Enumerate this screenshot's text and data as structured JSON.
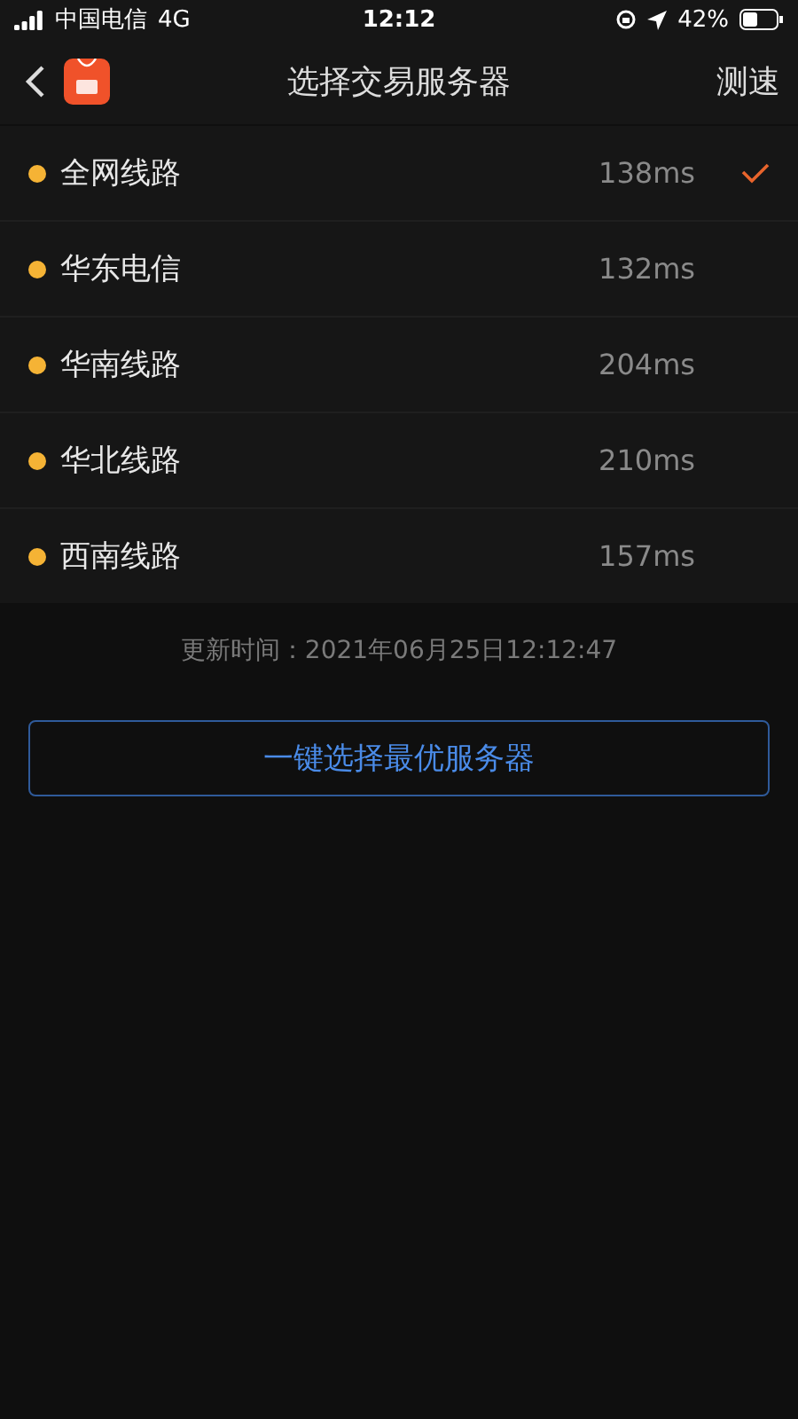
{
  "status_bar": {
    "carrier": "中国电信",
    "network": "4G",
    "time": "12:12",
    "battery": "42%"
  },
  "nav": {
    "title": "选择交易服务器",
    "action": "测速"
  },
  "servers": [
    {
      "name": "全网线路",
      "latency": "138ms",
      "color": "#f5b335",
      "selected": true
    },
    {
      "name": "华东电信",
      "latency": "132ms",
      "color": "#f5b335",
      "selected": false
    },
    {
      "name": "华南线路",
      "latency": "204ms",
      "color": "#f5b335",
      "selected": false
    },
    {
      "name": "华北线路",
      "latency": "210ms",
      "color": "#f5b335",
      "selected": false
    },
    {
      "name": "西南线路",
      "latency": "157ms",
      "color": "#f5b335",
      "selected": false
    }
  ],
  "update_time": "更新时间：2021年06月25日12:12:47",
  "optimize_button": "一键选择最优服务器"
}
